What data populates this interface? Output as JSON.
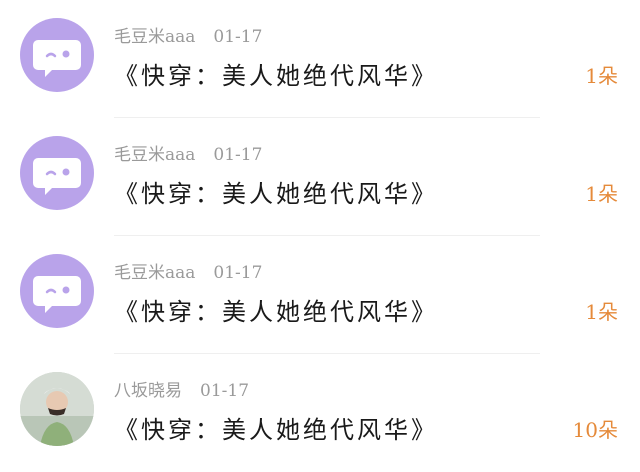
{
  "items": [
    {
      "user": "毛豆米aaa",
      "date": "01-17",
      "title": "《快穿：美人她绝代风华》",
      "amount": "1朵",
      "avatar": "default-chat-bubble-avatar"
    },
    {
      "user": "毛豆米aaa",
      "date": "01-17",
      "title": "《快穿：美人她绝代风华》",
      "amount": "1朵",
      "avatar": "default-chat-bubble-avatar"
    },
    {
      "user": "毛豆米aaa",
      "date": "01-17",
      "title": "《快穿：美人她绝代风华》",
      "amount": "1朵",
      "avatar": "default-chat-bubble-avatar"
    },
    {
      "user": "八坂晓易",
      "date": "01-17",
      "title": "《快穿：美人她绝代风华》",
      "amount": "10朵",
      "avatar": "photo-avatar"
    }
  ],
  "colors": {
    "avatar_purple": "#b9a3ea",
    "amount": "#e58a3a",
    "meta": "#9a9a9a",
    "title": "#1a1a1a"
  }
}
